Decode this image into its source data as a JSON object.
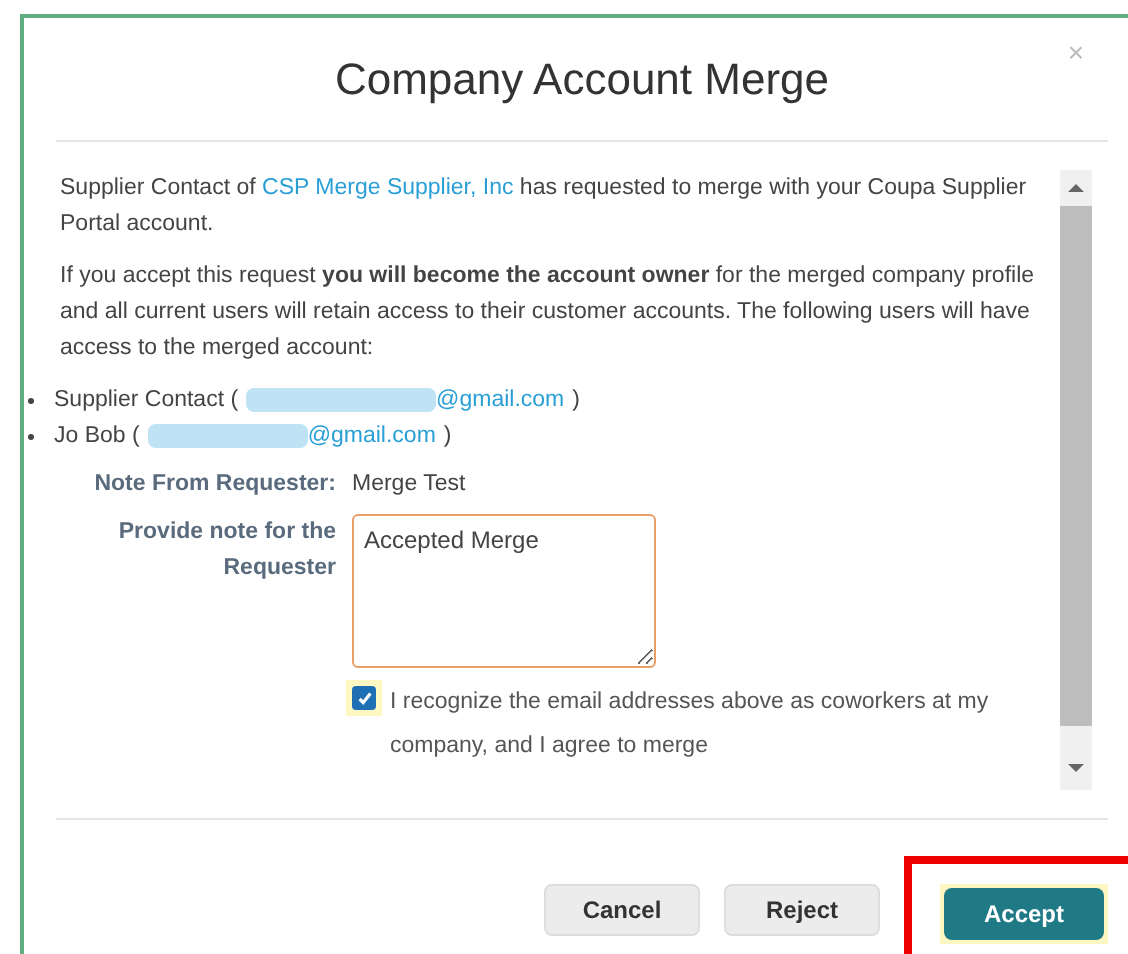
{
  "dialog": {
    "title": "Company Account Merge",
    "close": "×"
  },
  "intro": {
    "before": "Supplier Contact of ",
    "link": "CSP Merge Supplier, Inc",
    "after": " has requested to merge with your Coupa Supplier Portal account."
  },
  "notice": "If you accept this request **you will become the account owner** for the merged company profile and all current users will retain access to their customer accounts. The following users will have access to the merged account:",
  "users": [
    {
      "name": "Supplier Contact (",
      "email": "@gmail.com",
      "close": ")"
    },
    {
      "name": "Jo Bob (",
      "email": "@gmail.com",
      "close": ")"
    }
  ],
  "note_from": {
    "label": "Note From Requester:",
    "value": "Merge Test"
  },
  "note_for": {
    "label": "Provide note for the Requester",
    "value": "Accepted Merge"
  },
  "agree": {
    "label": "I recognize the email addresses above as coworkers at my company, and I agree to merge",
    "checked": true
  },
  "buttons": [
    {
      "label": "Cancel",
      "kind": "secondary"
    },
    {
      "label": "Reject",
      "kind": "secondary"
    },
    {
      "label": "Accept",
      "kind": "primary",
      "highlighted": true
    }
  ]
}
